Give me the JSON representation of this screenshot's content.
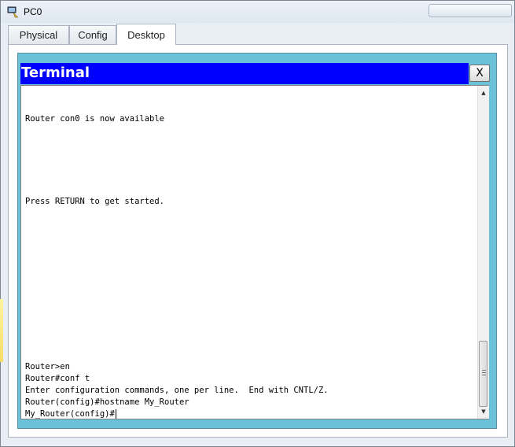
{
  "window": {
    "title": "PC0",
    "accent": "#0000ff",
    "frame_color": "#6bc2d8"
  },
  "tabs": [
    {
      "label": "Physical"
    },
    {
      "label": "Config"
    },
    {
      "label": "Desktop"
    }
  ],
  "active_tab": "Desktop",
  "terminal": {
    "title": "Terminal",
    "close_label": "X",
    "lines": [
      "Router con0 is now available",
      "Press RETURN to get started.",
      "Router>en",
      "Router#conf t",
      "Enter configuration commands, one per line.  End with CNTL/Z.",
      "Router(config)#hostname My_Router",
      "My_Router(config)#"
    ]
  },
  "icons": {
    "app": "packet-tracer-pc-icon",
    "scroll_up": "scroll-up-arrow-icon",
    "scroll_down": "scroll-down-arrow-icon"
  }
}
